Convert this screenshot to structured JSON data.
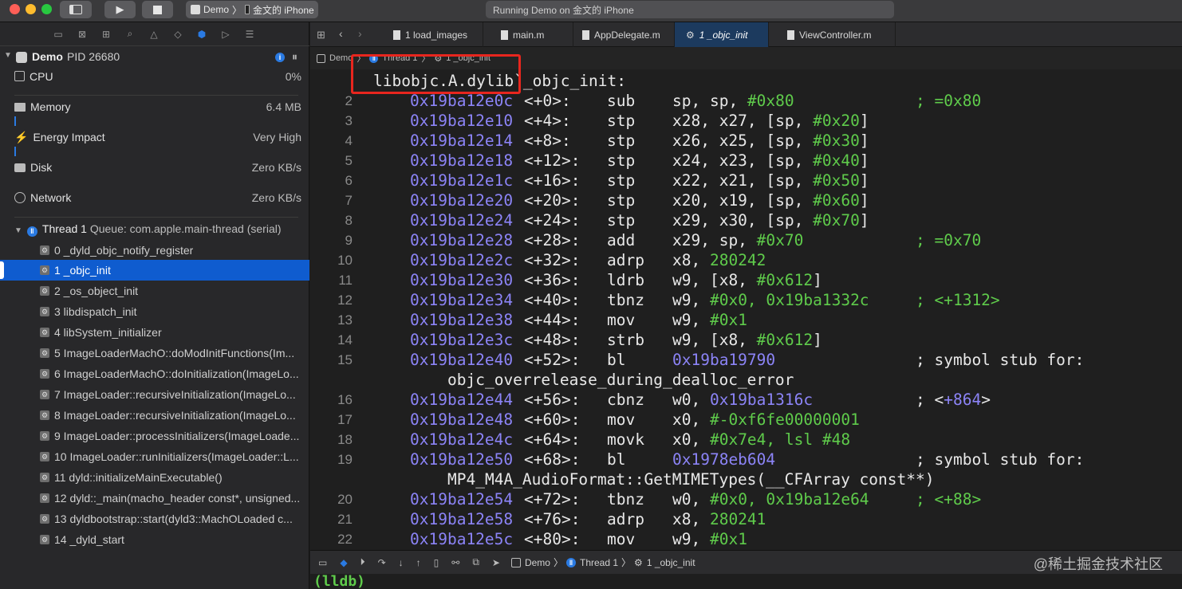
{
  "titlebar": {
    "scheme_target": "Demo",
    "device": "金文的 iPhone",
    "status": "Running Demo on 金文的 iPhone"
  },
  "navigator": {
    "process": {
      "name": "Demo",
      "pid": "PID 26680"
    },
    "gauges": [
      {
        "label": "CPU",
        "value": "0%"
      },
      {
        "label": "Memory",
        "value": "6.4 MB"
      },
      {
        "label": "Energy Impact",
        "value": "Very High"
      },
      {
        "label": "Disk",
        "value": "Zero KB/s"
      },
      {
        "label": "Network",
        "value": "Zero KB/s"
      }
    ],
    "thread": {
      "name": "Thread 1",
      "queue": "Queue: com.apple.main-thread (serial)"
    },
    "frames": [
      "0 _dyld_objc_notify_register",
      "1 _objc_init",
      "2 _os_object_init",
      "3 libdispatch_init",
      "4 libSystem_initializer",
      "5 ImageLoaderMachO::doModInitFunctions(Im...",
      "6 ImageLoaderMachO::doInitialization(ImageLo...",
      "7 ImageLoader::recursiveInitialization(ImageLo...",
      "8 ImageLoader::recursiveInitialization(ImageLo...",
      "9 ImageLoader::processInitializers(ImageLoade...",
      "10 ImageLoader::runInitializers(ImageLoader::L...",
      "11 dyld::initializeMainExecutable()",
      "12 dyld::_main(macho_header const*, unsigned...",
      "13 dyldbootstrap::start(dyld3::MachOLoaded c...",
      "14 _dyld_start"
    ],
    "selected_frame": 1
  },
  "tabs": [
    {
      "label": "1 load_images"
    },
    {
      "label": "main.m"
    },
    {
      "label": "AppDelegate.m"
    },
    {
      "label": "1 _objc_init"
    },
    {
      "label": "ViewController.m"
    }
  ],
  "jumpbar": {
    "target": "Demo",
    "thread": "Thread 1",
    "frame": "1 _objc_init"
  },
  "code": {
    "header": "libobjc.A.dylib`_objc_init:",
    "lines": [
      {
        "n": "2",
        "addr": "0x19ba12e0c",
        "off": "<+0>:",
        "op": "sub",
        "args": "sp, sp, ",
        "imm": "#0x80",
        "comment": "; =0x80"
      },
      {
        "n": "3",
        "addr": "0x19ba12e10",
        "off": "<+4>:",
        "op": "stp",
        "args": "x28, x27, [sp, ",
        "imm": "#0x20",
        "tail": "]"
      },
      {
        "n": "4",
        "addr": "0x19ba12e14",
        "off": "<+8>:",
        "op": "stp",
        "args": "x26, x25, [sp, ",
        "imm": "#0x30",
        "tail": "]"
      },
      {
        "n": "5",
        "addr": "0x19ba12e18",
        "off": "<+12>:",
        "op": "stp",
        "args": "x24, x23, [sp, ",
        "imm": "#0x40",
        "tail": "]"
      },
      {
        "n": "6",
        "addr": "0x19ba12e1c",
        "off": "<+16>:",
        "op": "stp",
        "args": "x22, x21, [sp, ",
        "imm": "#0x50",
        "tail": "]"
      },
      {
        "n": "7",
        "addr": "0x19ba12e20",
        "off": "<+20>:",
        "op": "stp",
        "args": "x20, x19, [sp, ",
        "imm": "#0x60",
        "tail": "]"
      },
      {
        "n": "8",
        "addr": "0x19ba12e24",
        "off": "<+24>:",
        "op": "stp",
        "args": "x29, x30, [sp, ",
        "imm": "#0x70",
        "tail": "]"
      },
      {
        "n": "9",
        "addr": "0x19ba12e28",
        "off": "<+28>:",
        "op": "add",
        "args": "x29, sp, ",
        "imm": "#0x70",
        "comment": "; =0x70"
      },
      {
        "n": "10",
        "addr": "0x19ba12e2c",
        "off": "<+32>:",
        "op": "adrp",
        "args": "x8, ",
        "imm": "280242"
      },
      {
        "n": "11",
        "addr": "0x19ba12e30",
        "off": "<+36>:",
        "op": "ldrb",
        "args": "w9, [x8, ",
        "imm": "#0x612",
        "tail": "]"
      },
      {
        "n": "12",
        "addr": "0x19ba12e34",
        "off": "<+40>:",
        "op": "tbnz",
        "args": "w9, ",
        "imm": "#0x0, 0x19ba1332c",
        "comment": "; <+1312>"
      },
      {
        "n": "13",
        "addr": "0x19ba12e38",
        "off": "<+44>:",
        "op": "mov",
        "args": "w9, ",
        "imm": "#0x1"
      },
      {
        "n": "14",
        "addr": "0x19ba12e3c",
        "off": "<+48>:",
        "op": "strb",
        "args": "w9, [x8, ",
        "imm": "#0x612",
        "tail": "]"
      },
      {
        "n": "15",
        "addr": "0x19ba12e40",
        "off": "<+52>:",
        "op": "bl",
        "args": "",
        "target": "0x19ba19790",
        "wcomment": "; symbol stub for:",
        "cont": "objc_overrelease_during_dealloc_error"
      },
      {
        "n": "16",
        "addr": "0x19ba12e44",
        "off": "<+56>:",
        "op": "cbnz",
        "args": "w0, ",
        "target": "0x19ba1316c",
        "wcomment": "; <",
        "wimm": "+864",
        "wtail": ">"
      },
      {
        "n": "17",
        "addr": "0x19ba12e48",
        "off": "<+60>:",
        "op": "mov",
        "args": "x0, ",
        "imm": "#-0xf6fe00000001"
      },
      {
        "n": "18",
        "addr": "0x19ba12e4c",
        "off": "<+64>:",
        "op": "movk",
        "args": "x0, ",
        "imm": "#0x7e4, lsl #48"
      },
      {
        "n": "19",
        "addr": "0x19ba12e50",
        "off": "<+68>:",
        "op": "bl",
        "args": "",
        "target": "0x1978eb604",
        "wcomment": "; symbol stub for:",
        "cont": "MP4_M4A_AudioFormat::GetMIMETypes(__CFArray const**)"
      },
      {
        "n": "20",
        "addr": "0x19ba12e54",
        "off": "<+72>:",
        "op": "tbnz",
        "args": "w0, ",
        "imm": "#0x0, 0x19ba12e64",
        "comment": "; <+88>"
      },
      {
        "n": "21",
        "addr": "0x19ba12e58",
        "off": "<+76>:",
        "op": "adrp",
        "args": "x8, ",
        "imm": "280241"
      },
      {
        "n": "22",
        "addr": "0x19ba12e5c",
        "off": "<+80>:",
        "op": "mov",
        "args": "w9, ",
        "imm": "#0x1"
      }
    ]
  },
  "debugbar": {
    "target": "Demo",
    "thread": "Thread 1",
    "frame": "1 _objc_init"
  },
  "console": {
    "prompt": "(lldb)"
  },
  "watermark": "@稀土掘金技术社区"
}
